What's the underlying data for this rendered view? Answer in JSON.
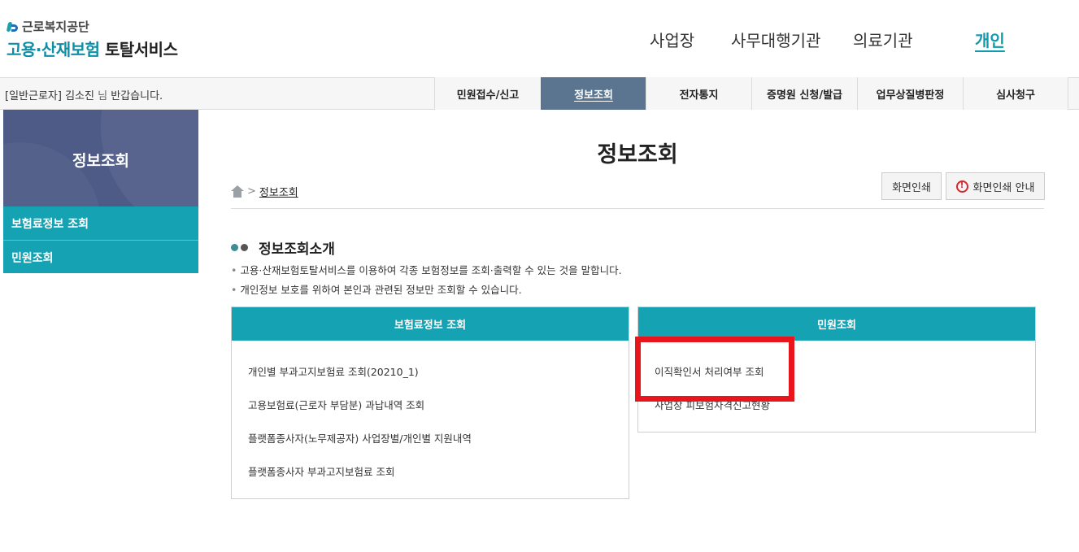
{
  "header": {
    "org_name": "근로복지공단",
    "service_name_accent": "고용·산재보험",
    "service_name_rest": "토탈서비스",
    "nav": [
      {
        "label": "사업장",
        "active": false
      },
      {
        "label": "사무대행기관",
        "active": false
      },
      {
        "label": "의료기관",
        "active": false
      },
      {
        "label": "개인",
        "active": true
      }
    ]
  },
  "subbar": {
    "user_type": "[일반근로자]",
    "user_name": "김소진",
    "honorific": "님",
    "greeting": "반갑습니다.",
    "menu": [
      {
        "label": "민원접수/신고",
        "active": false
      },
      {
        "label": "정보조회",
        "active": true
      },
      {
        "label": "전자통지",
        "active": false
      },
      {
        "label": "증명원 신청/발급",
        "active": false
      },
      {
        "label": "업무상질병판정",
        "active": false
      },
      {
        "label": "심사청구",
        "active": false
      }
    ]
  },
  "sidebar": {
    "title": "정보조회",
    "items": [
      {
        "label": "보험료정보 조회"
      },
      {
        "label": "민원조회"
      }
    ]
  },
  "main": {
    "page_title": "정보조회",
    "breadcrumb": {
      "separator": ">",
      "current": "정보조회"
    },
    "buttons": {
      "print": "화면인쇄",
      "print_guide": "화면인쇄 안내"
    },
    "section_title": "정보조회소개",
    "descriptions": [
      "고용·산재보험토탈서비스를 이용하여 각종 보험정보를 조회·출력할 수 있는 것을 말합니다.",
      "개인정보 보호를 위하여 본인과 관련된 정보만 조회할 수 있습니다."
    ],
    "panels": [
      {
        "title": "보험료정보 조회",
        "links": [
          "개인별 부과고지보험료 조회(20210_1)",
          "고용보험료(근로자 부담분) 과납내역 조회",
          "플랫폼종사자(노무제공자) 사업장별/개인별 지원내역",
          "플랫폼종사자 부과고지보험료 조회"
        ]
      },
      {
        "title": "민원조회",
        "links": [
          "이직확인서 처리여부 조회",
          "사업장 피보험자격신고현황"
        ]
      }
    ]
  },
  "colors": {
    "teal": "#15a3b4",
    "navy_hero": "#4e5b86",
    "active_menu": "#5b7590",
    "highlight_red": "#e8151c"
  }
}
